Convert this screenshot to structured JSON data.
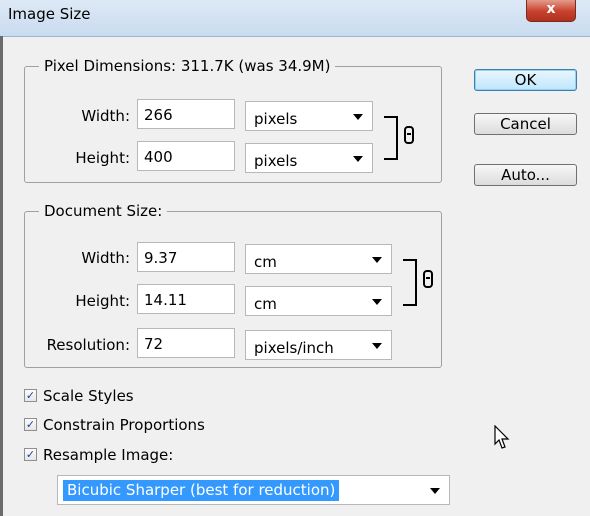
{
  "window": {
    "title": "Image Size",
    "close_label": "x"
  },
  "pixel_dimensions": {
    "legend": "Pixel Dimensions:  311.7K (was 34.9M)",
    "width_label": "Width:",
    "width_value": "266",
    "width_unit": "pixels",
    "height_label": "Height:",
    "height_value": "400",
    "height_unit": "pixels"
  },
  "document_size": {
    "legend": "Document Size:",
    "width_label": "Width:",
    "width_value": "9.37",
    "width_unit": "cm",
    "height_label": "Height:",
    "height_value": "14.11",
    "height_unit": "cm",
    "resolution_label": "Resolution:",
    "resolution_value": "72",
    "resolution_unit": "pixels/inch"
  },
  "buttons": {
    "ok": "OK",
    "cancel": "Cancel",
    "auto": "Auto..."
  },
  "checkboxes": {
    "scale_styles": {
      "label": "Scale Styles",
      "checked": true
    },
    "constrain_proportions": {
      "label": "Constrain Proportions",
      "checked": true
    },
    "resample_image": {
      "label": "Resample Image:",
      "checked": true
    }
  },
  "resample_method": "Bicubic Sharper (best for reduction)"
}
